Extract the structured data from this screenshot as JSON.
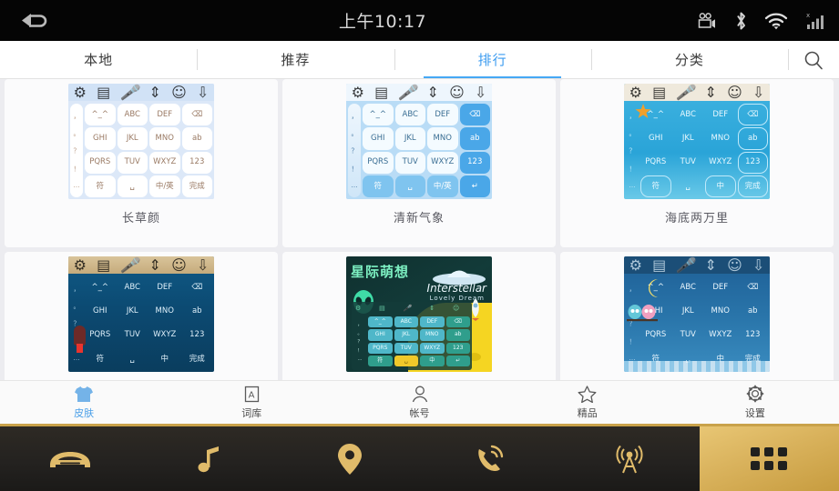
{
  "statusbar": {
    "back_icon": "back-arrow-icon",
    "time": "上午10:17",
    "icons": [
      "video-camera-icon",
      "bluetooth-icon",
      "wifi-icon",
      "signal-icon"
    ]
  },
  "tabs": [
    {
      "label": "本地",
      "active": false
    },
    {
      "label": "推荐",
      "active": false
    },
    {
      "label": "排行",
      "active": true
    },
    {
      "label": "分类",
      "active": false
    }
  ],
  "search": {
    "icon": "search-icon"
  },
  "skins": [
    {
      "name": "长草颜",
      "theme": "pale-blue"
    },
    {
      "name": "清新气象",
      "theme": "cloud-blue"
    },
    {
      "name": "海底两万里",
      "theme": "ocean"
    },
    {
      "name": "",
      "theme": "bamboo-night"
    },
    {
      "name": "",
      "theme": "interstellar",
      "title_cn": "星际萌想",
      "title_en": "Interstellar",
      "subtitle_en": "Lovely Dream"
    },
    {
      "name": "",
      "theme": "moon-owl"
    }
  ],
  "keyboard_keys": {
    "row1": [
      "^_^",
      "ABC",
      "DEF",
      "⌫"
    ],
    "row2": [
      "GHI",
      "JKL",
      "MNO",
      "ab"
    ],
    "row3": [
      "PQRS",
      "TUV",
      "WXYZ",
      "123"
    ],
    "row4": [
      "符",
      "———",
      "中/英",
      "完成"
    ],
    "sidebar": [
      "，",
      "。",
      "？",
      "！",
      "…"
    ]
  },
  "bottomnav": [
    {
      "label": "皮肤",
      "icon": "tshirt-icon",
      "active": true
    },
    {
      "label": "词库",
      "icon": "dictionary-icon",
      "active": false
    },
    {
      "label": "帐号",
      "icon": "person-icon",
      "active": false
    },
    {
      "label": "精品",
      "icon": "star-icon",
      "active": false
    },
    {
      "label": "设置",
      "icon": "gear-icon",
      "active": false
    }
  ],
  "dock": [
    {
      "icon": "car-icon",
      "active": false
    },
    {
      "icon": "music-note-icon",
      "active": false
    },
    {
      "icon": "location-pin-icon",
      "active": false
    },
    {
      "icon": "phone-icon",
      "active": false
    },
    {
      "icon": "radio-tower-icon",
      "active": false
    },
    {
      "icon": "apps-grid-icon",
      "active": true
    }
  ],
  "colors": {
    "accent_blue": "#45a8f5",
    "dock_gold": "#d9b25c",
    "page_bg": "#ececf0"
  }
}
